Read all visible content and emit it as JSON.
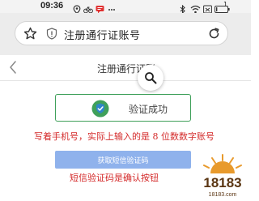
{
  "status_bar": {
    "time": "09:36",
    "battery_level": "1"
  },
  "browser": {
    "address_text": "注册通行证账号"
  },
  "page": {
    "title": "注册通行证账"
  },
  "verify": {
    "label": "验证成功"
  },
  "annotations": {
    "top": "写着手机号，实际上输入的是 8 位数数字账号",
    "bottom": "短信验证码是确认按钮"
  },
  "sms_button": {
    "label": "获取短信验证码"
  },
  "watermark": {
    "text": "18183",
    "sub_text": "18183.com"
  },
  "colors": {
    "success_green": "#3fa05a",
    "annotation_red": "#d42a2a",
    "button_blue": "#8fb2ec",
    "logo_orange": "#e89a2c"
  }
}
